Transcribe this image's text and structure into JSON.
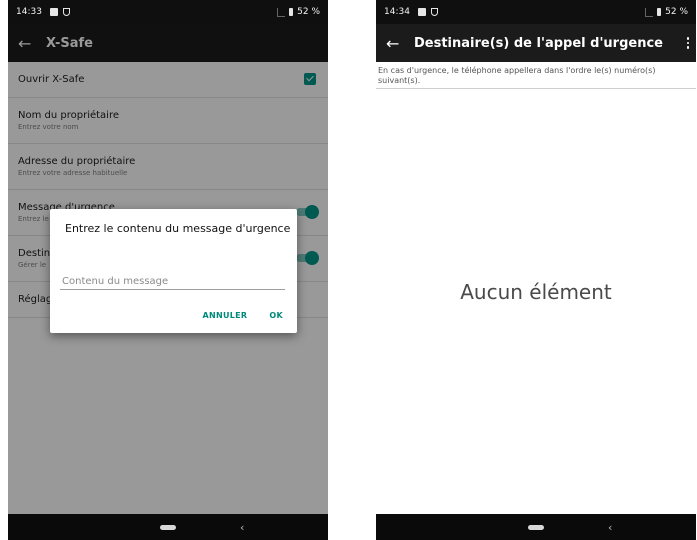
{
  "left": {
    "status": {
      "time": "14:33",
      "battery": "52 %"
    },
    "app_bar": {
      "title": "X-Safe"
    },
    "prefs": [
      {
        "title": "Ouvrir X-Safe",
        "summary": ""
      },
      {
        "title": "Nom du propriétaire",
        "summary": "Entrez votre nom"
      },
      {
        "title": "Adresse du propriétaire",
        "summary": "Entrez votre adresse habituelle"
      },
      {
        "title": "Message d'urgence",
        "summary": "Entrez le"
      },
      {
        "title": "Destina",
        "summary": "Gérer le"
      },
      {
        "title": "Réglage",
        "summary": ""
      }
    ],
    "dialog": {
      "title": "Entrez le contenu du message d'urgence",
      "placeholder": "Contenu du message",
      "cancel": "ANNULER",
      "ok": "OK"
    }
  },
  "right": {
    "status": {
      "time": "14:34",
      "battery": "52 %"
    },
    "app_bar": {
      "title": "Destinaire(s) de l'appel d'urgence"
    },
    "intro": "En cas d'urgence, le téléphone appellera dans l'ordre le(s) numéro(s) suivant(s).",
    "empty": "Aucun élément"
  },
  "colors": {
    "accent": "#009688",
    "app_bar": "#1b1b1b",
    "status_bar": "#0f0f0f"
  }
}
